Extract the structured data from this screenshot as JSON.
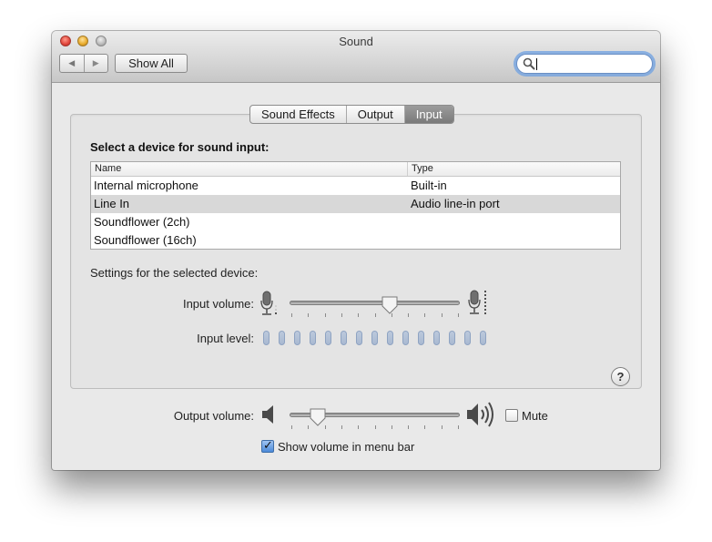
{
  "window": {
    "title": "Sound",
    "toolbar": {
      "back_glyph": "◀",
      "forward_glyph": "▶",
      "show_all_label": "Show All",
      "search_placeholder": "",
      "search_value": ""
    }
  },
  "tabs": [
    {
      "label": "Sound Effects",
      "selected": false
    },
    {
      "label": "Output",
      "selected": false
    },
    {
      "label": "Input",
      "selected": true
    }
  ],
  "input": {
    "section_title": "Select a device for sound input:",
    "table": {
      "columns": [
        "Name",
        "Type"
      ],
      "rows": [
        {
          "name": "Internal microphone",
          "type": "Built-in",
          "selected": false
        },
        {
          "name": "Line In",
          "type": "Audio line-in port",
          "selected": true
        },
        {
          "name": "Soundflower (2ch)",
          "type": "",
          "selected": false
        },
        {
          "name": "Soundflower (16ch)",
          "type": "",
          "selected": false
        }
      ]
    },
    "settings_label": "Settings for the selected device:",
    "input_volume_label": "Input volume:",
    "input_volume_level": 0.59,
    "input_level_label": "Input level:",
    "input_level_segments": 15,
    "input_level_active": 0,
    "help_glyph": "?"
  },
  "output": {
    "output_volume_label": "Output volume:",
    "output_volume_level": 0.16,
    "mute_label": "Mute",
    "mute_checked": false,
    "show_volume_label": "Show volume in menu bar",
    "show_volume_checked": true
  },
  "colors": {
    "selected_row": "#d8d8d8",
    "search_focus": "#6ea0e1",
    "level_led": "#a9b9d1",
    "active_tab": "#7a7a7a"
  },
  "icons": {
    "search": "magnifier-icon",
    "mic_low": "microphone-low-icon",
    "mic_high": "microphone-high-icon",
    "speaker_low": "speaker-low-icon",
    "speaker_high": "speaker-high-icon",
    "checkmark": "✓"
  }
}
